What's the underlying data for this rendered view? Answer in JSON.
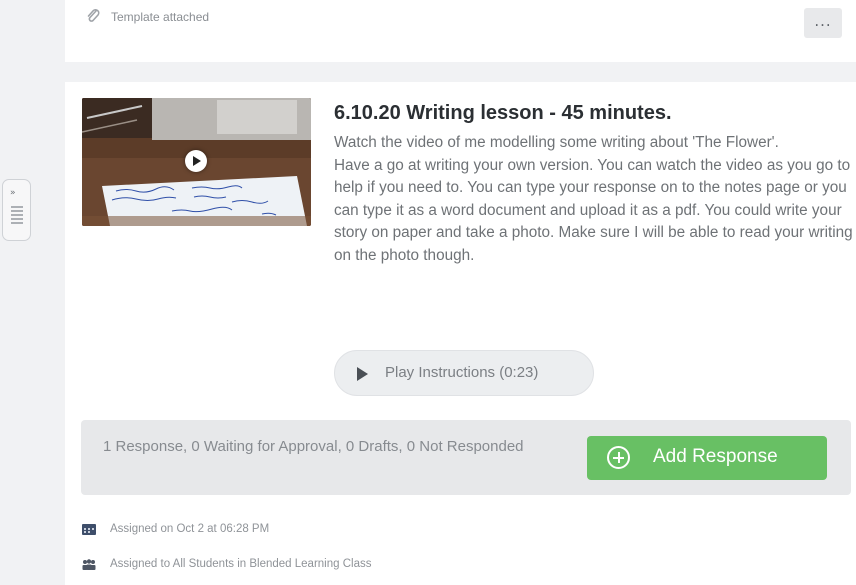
{
  "top_card": {
    "attachment_label": "Template attached",
    "more_label": "..."
  },
  "side_handle": {
    "chevron": "»"
  },
  "activity": {
    "title": "6.10.20 Writing lesson - 45 minutes.",
    "description": [
      "Watch the video of me modelling some writing about 'The Flower'.",
      "Have a go at writing your own version. You can watch the video as you go to help if you need to. You can type your response on to the notes page or you can type it as a word document and upload it as a pdf. You could write your story on paper and take a photo. Make sure I will be able to read your writing on the photo though."
    ],
    "play_instructions_label": "Play Instructions (0:23)",
    "response_summary": "1 Response, 0 Waiting for Approval, 0 Drafts, 0 Not Responded",
    "add_response_label": "Add Response",
    "assigned_on": "Assigned on Oct 2 at 06:28 PM",
    "assigned_to": "Assigned to All Students in Blended Learning Class"
  },
  "icons": {
    "attachment": "paperclip-icon",
    "more": "more-icon",
    "video_play": "play-icon",
    "play_instructions": "play-icon",
    "add_response": "plus-circle-icon",
    "calendar": "calendar-icon",
    "students": "group-icon"
  },
  "colors": {
    "accent_green": "#68c064",
    "background": "#f1f2f4",
    "title_text": "#2b2f33"
  }
}
